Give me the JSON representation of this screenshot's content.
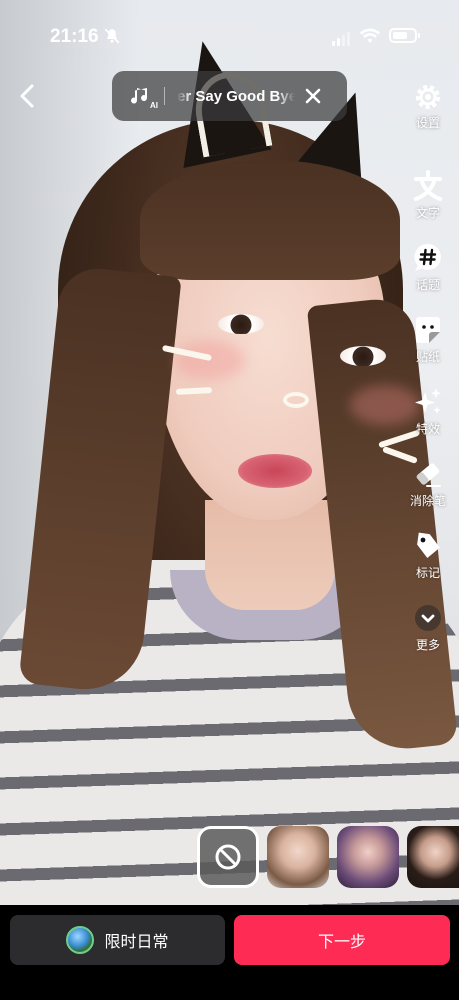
{
  "status_bar": {
    "time": "21:16",
    "battery_level": 0.7
  },
  "music": {
    "ai_badge": "AI",
    "title": "er Say Good Bye"
  },
  "toolbar": {
    "items": [
      {
        "label": "设置",
        "icon": "gear-icon"
      },
      {
        "label": "文字",
        "icon": "text-icon"
      },
      {
        "label": "话题",
        "icon": "hashtag-icon"
      },
      {
        "label": "贴纸",
        "icon": "sticker-icon"
      },
      {
        "label": "特效",
        "icon": "sparkle-icon"
      },
      {
        "label": "消除笔",
        "icon": "eraser-icon"
      },
      {
        "label": "标记",
        "icon": "tag-icon"
      },
      {
        "label": "更多",
        "icon": "chevron-down-icon"
      }
    ]
  },
  "effects": {
    "items": [
      "none-icon",
      "portrait-effect-1",
      "portrait-effect-2",
      "portrait-effect-3"
    ]
  },
  "bottom": {
    "daily_label": "限时日常",
    "next_label": "下一步"
  },
  "colors": {
    "accent": "#fe2c55",
    "secondary_button": "#2c2c2e"
  }
}
